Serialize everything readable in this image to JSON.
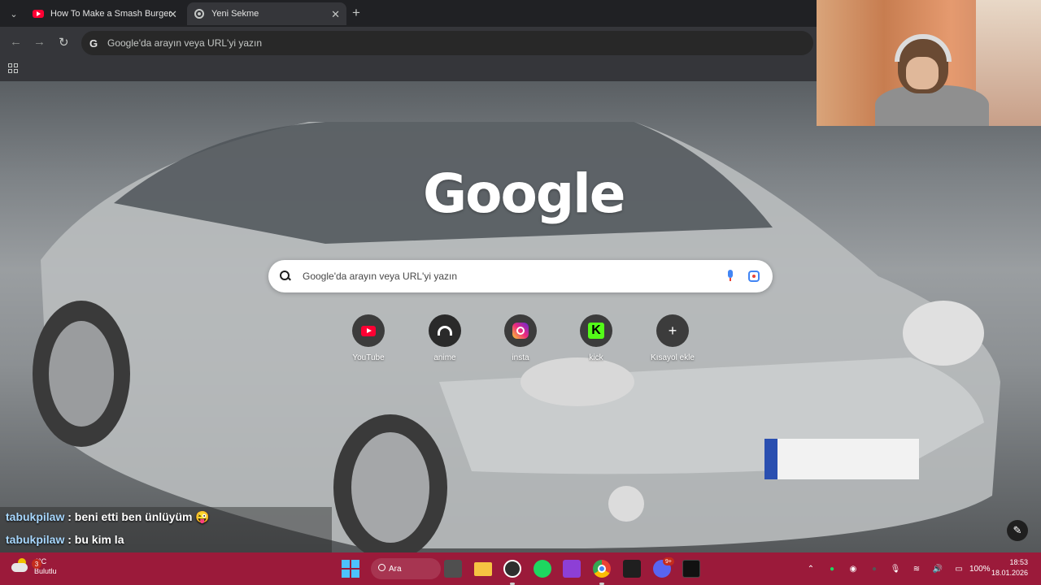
{
  "tabs": [
    {
      "title": "How To Make a Smash Burger",
      "favicon": "youtube-icon"
    },
    {
      "title": "Yeni Sekme",
      "favicon": "chrome-icon",
      "active": true
    }
  ],
  "toolbar": {
    "omnibox_placeholder": "Google'da arayın veya URL'yi yazın"
  },
  "ntp": {
    "logo": "Google",
    "search_placeholder": "Google'da arayın veya URL'yi yazın",
    "shortcuts": [
      {
        "label": "YouTube",
        "icon": "youtube-icon"
      },
      {
        "label": "anime",
        "icon": "anime-icon"
      },
      {
        "label": "insta",
        "icon": "instagram-icon"
      },
      {
        "label": "kick",
        "icon": "kick-icon"
      },
      {
        "label": "Kısayol ekle",
        "icon": "plus-icon"
      }
    ]
  },
  "chat": [
    {
      "user": "tabukpilaw",
      "message": ": beni etti ben ünlüyüm 😜"
    },
    {
      "user": "tabukpilaw",
      "message": ": bu kim la"
    }
  ],
  "taskbar": {
    "weather_temp": "4°C",
    "weather_desc": "Bulutlu",
    "weather_badge": "3",
    "search_label": "Ara",
    "discord_badge": "9+",
    "battery": "100%",
    "time": "18:53",
    "date": "18.01.2026",
    "accent": "#9b1a3a"
  }
}
